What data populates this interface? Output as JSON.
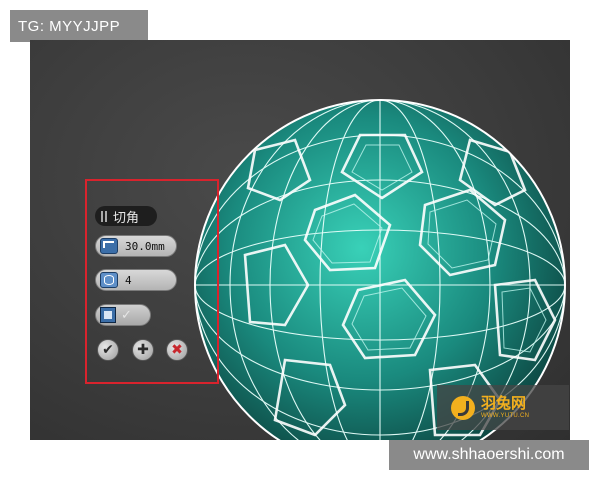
{
  "watermarks": {
    "top_left": "TG: MYYJJPP",
    "bottom_right": "www.shhaoershi.com"
  },
  "caddy": {
    "title": "切角",
    "amount_value": "30.0mm",
    "segments_value": "4",
    "amount_icon": "chamfer-amount-icon",
    "segments_icon": "segments-icon",
    "toggle_icon": "open-chamfer-icon",
    "ok_glyph": "✔",
    "apply_glyph": "✚",
    "cancel_glyph": "✖"
  },
  "logo": {
    "name": "羽兔网",
    "url": "WWW.YUTU.CN",
    "accent_color": "#f2b01e"
  },
  "viewport": {
    "background_color": "#3c3c3c",
    "object_color": "#1f8f84",
    "wireframe_color": "#ffffff",
    "selection_frame_color": "#d9232d"
  }
}
